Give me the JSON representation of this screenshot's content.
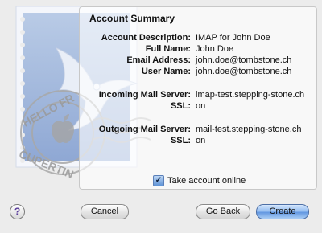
{
  "summary": {
    "title": "Account Summary",
    "rows": [
      {
        "label": "Account Description:",
        "value": "IMAP for John Doe"
      },
      {
        "label": "Full Name:",
        "value": "John Doe"
      },
      {
        "label": "Email Address:",
        "value": "john.doe@tombstone.ch"
      },
      {
        "label": "User Name:",
        "value": "john.doe@tombstone.ch"
      },
      {
        "label": "Incoming Mail Server:",
        "value": "imap-test.stepping-stone.ch"
      },
      {
        "label": "SSL:",
        "value": "on"
      },
      {
        "label": "Outgoing Mail Server:",
        "value": "mail-test.stepping-stone.ch"
      },
      {
        "label": "SSL:",
        "value": "on"
      }
    ]
  },
  "stamp": {
    "text_top": "HELLO FR",
    "text_bottom": "CUPERTIN"
  },
  "take_online": {
    "label": "Take account online",
    "checked": true,
    "check_glyph": "✓"
  },
  "buttons": {
    "help": "?",
    "cancel": "Cancel",
    "back": "Go Back",
    "create": "Create"
  }
}
